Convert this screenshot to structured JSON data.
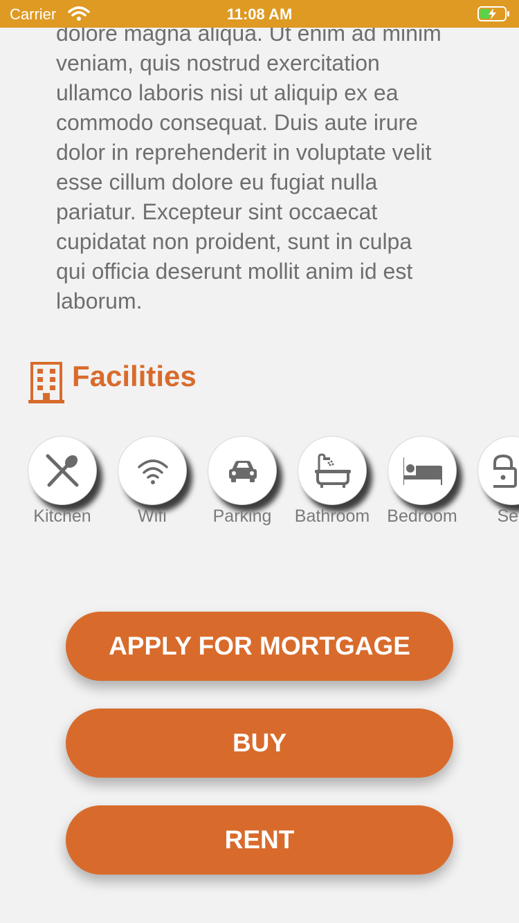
{
  "status_bar": {
    "carrier": "Carrier",
    "time": "11:08 AM"
  },
  "description": "dolore magna aliqua. Ut enim ad minim\nveniam, quis nostrud exercitation\nullamco laboris nisi ut aliquip ex ea\ncommodo consequat. Duis aute irure\ndolor in reprehenderit in voluptate velit\nesse cillum dolore eu fugiat nulla\npariatur. Excepteur sint occaecat\ncupidatat non proident, sunt in culpa\nqui officia deserunt mollit anim id est\nlaborum.",
  "facilities": {
    "title": "Facilities",
    "icon": "building-icon",
    "items": [
      {
        "label": "Kitchen",
        "icon": "utensils-icon"
      },
      {
        "label": "Wifi",
        "icon": "wifi-icon"
      },
      {
        "label": "Parking",
        "icon": "car-icon"
      },
      {
        "label": "Bathroom",
        "icon": "bathtub-icon"
      },
      {
        "label": "Bedroom",
        "icon": "bed-icon"
      },
      {
        "label": "Sec",
        "icon": "lock-icon"
      }
    ]
  },
  "actions": {
    "mortgage_label": "APPLY FOR MORTGAGE",
    "buy_label": "BUY",
    "rent_label": "RENT"
  },
  "colors": {
    "status_bar": "#de9a22",
    "accent": "#d86b2c",
    "background": "#f2f2f2",
    "body_text": "#6e6e6e",
    "icon_gray": "#6a6a6a"
  }
}
